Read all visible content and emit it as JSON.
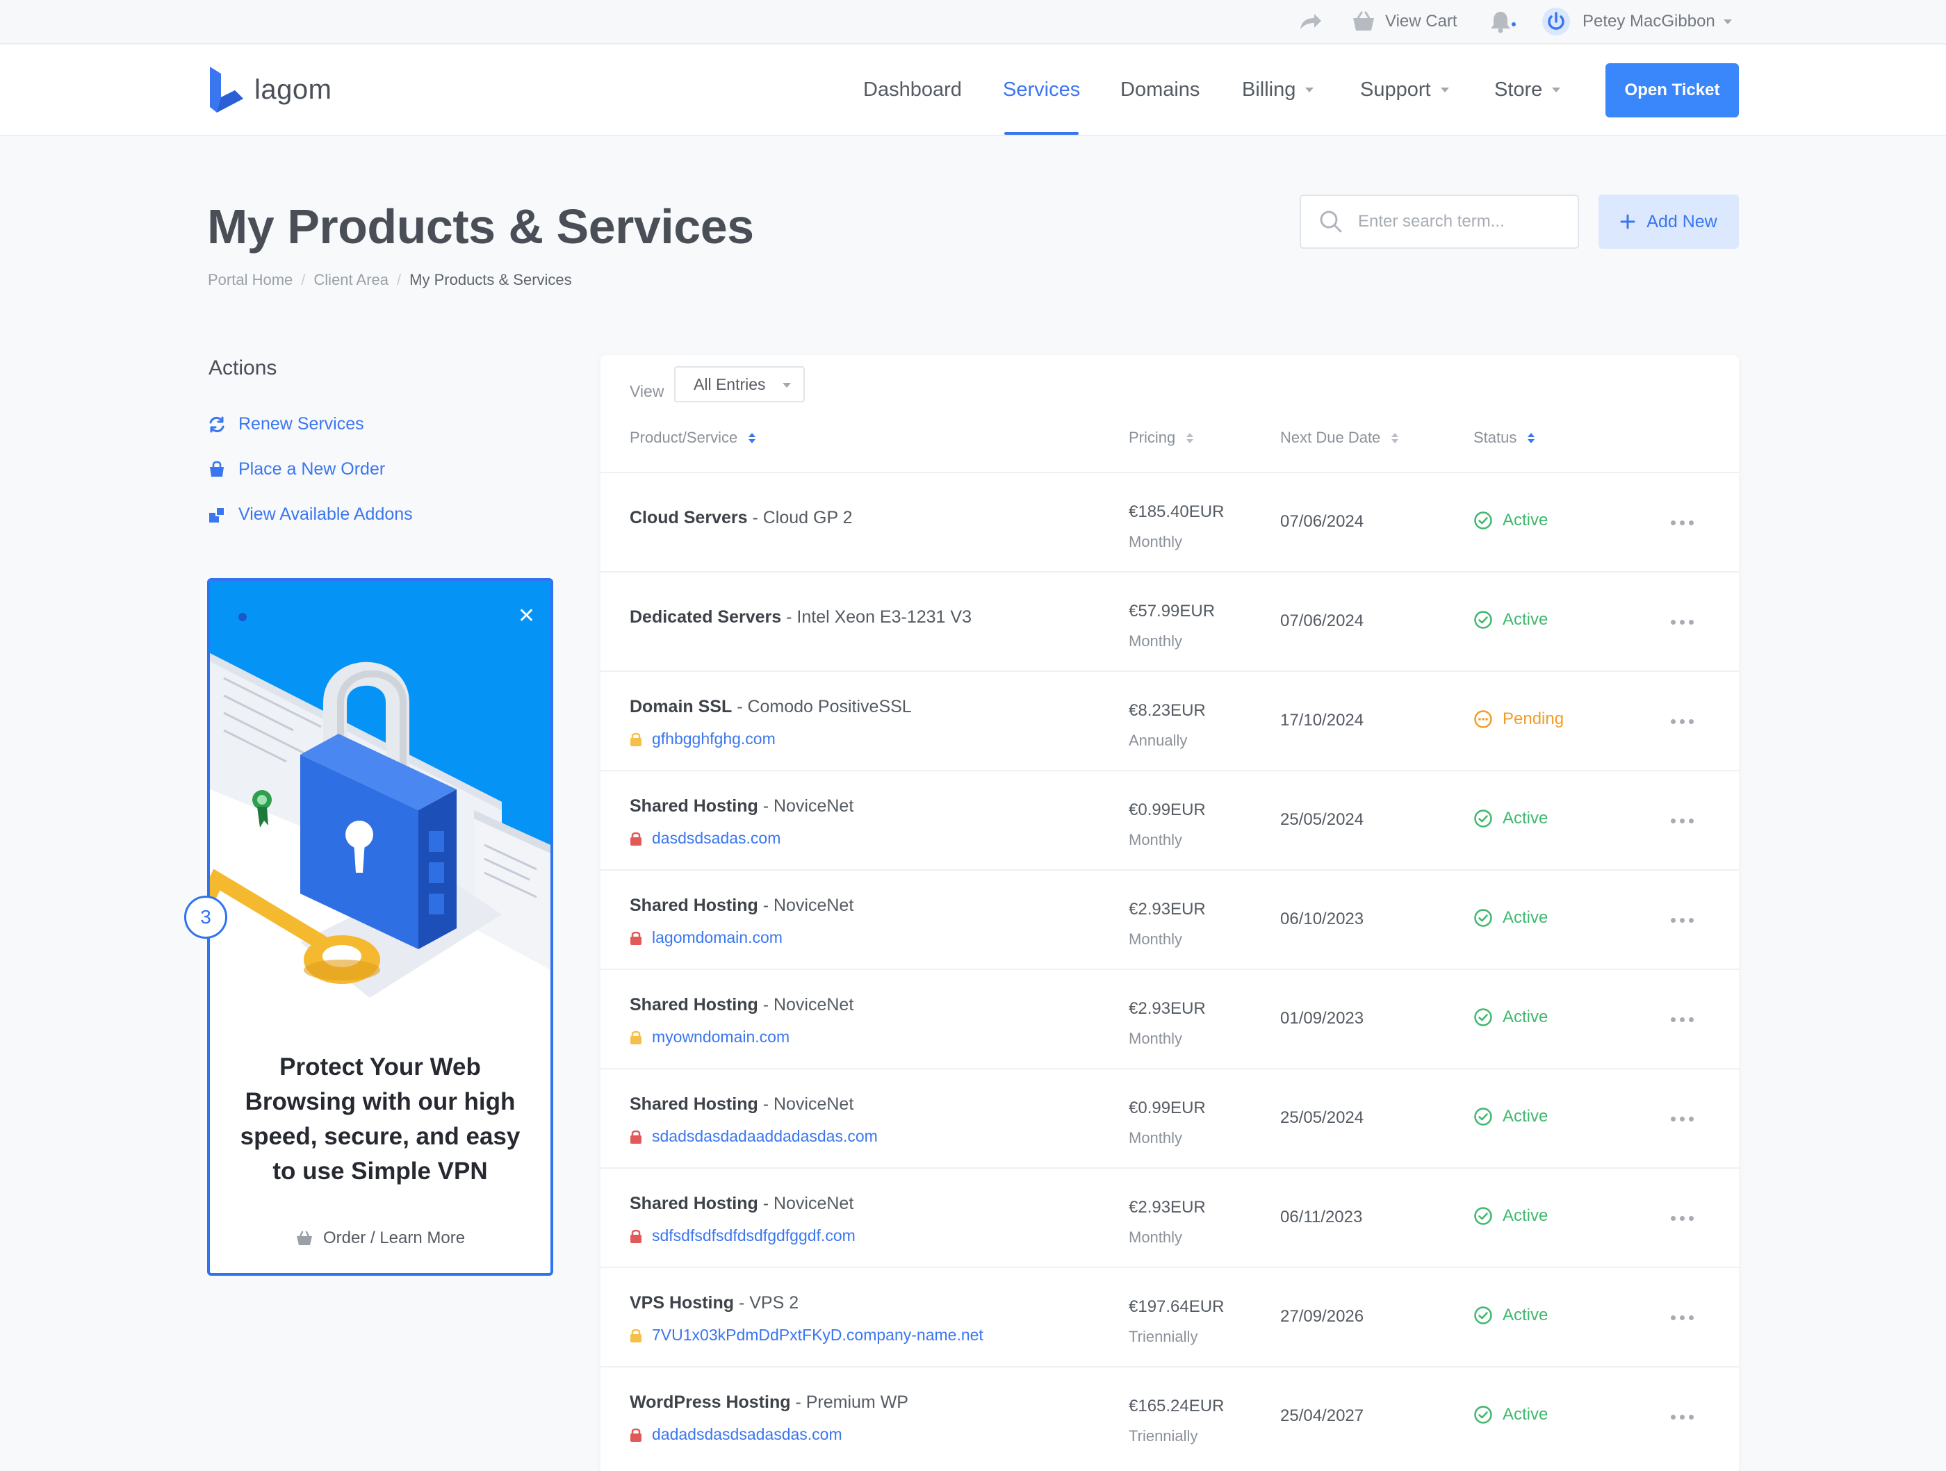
{
  "topbar": {
    "view_cart": "View Cart",
    "user_name": "Petey MacGibbon"
  },
  "brand": {
    "name": "lagom",
    "accent": "#3a76f0"
  },
  "nav": {
    "items": [
      {
        "label": "Dashboard",
        "dropdown": false,
        "active": false
      },
      {
        "label": "Services",
        "dropdown": false,
        "active": true
      },
      {
        "label": "Domains",
        "dropdown": false,
        "active": false
      },
      {
        "label": "Billing",
        "dropdown": true,
        "active": false
      },
      {
        "label": "Support",
        "dropdown": true,
        "active": false
      },
      {
        "label": "Store",
        "dropdown": true,
        "active": false
      }
    ],
    "open_ticket": "Open Ticket"
  },
  "page": {
    "title": "My Products & Services",
    "breadcrumb": [
      "Portal Home",
      "Client Area",
      "My Products & Services"
    ],
    "search_placeholder": "Enter search term...",
    "add_new": "Add New"
  },
  "sidebar": {
    "actions_title": "Actions",
    "actions": [
      {
        "label": "Renew Services",
        "icon": "refresh-icon"
      },
      {
        "label": "Place a New Order",
        "icon": "cart-icon"
      },
      {
        "label": "View Available Addons",
        "icon": "addons-icon"
      }
    ],
    "promo": {
      "headline": "Protect Your Web Browsing with our high speed, secure, and easy to use Simple VPN",
      "link": "Order / Learn More",
      "step_badge": "3"
    }
  },
  "table": {
    "view_label": "View",
    "view_value": "All Entries",
    "headers": {
      "product": "Product/Service",
      "pricing": "Pricing",
      "due": "Next Due Date",
      "status": "Status"
    },
    "rows": [
      {
        "group": "Cloud Servers",
        "product": " - Cloud GP 2",
        "domain": "",
        "lock": "",
        "price": "€185.40EUR",
        "cycle": "Monthly",
        "due": "07/06/2024",
        "status": "Active"
      },
      {
        "group": "Dedicated Servers",
        "product": " - Intel Xeon E3-1231 V3",
        "domain": "",
        "lock": "",
        "price": "€57.99EUR",
        "cycle": "Monthly",
        "due": "07/06/2024",
        "status": "Active"
      },
      {
        "group": "Domain SSL",
        "product": " - Comodo PositiveSSL",
        "domain": "gfhbgghfghg.com",
        "lock": "yellow",
        "price": "€8.23EUR",
        "cycle": "Annually",
        "due": "17/10/2024",
        "status": "Pending"
      },
      {
        "group": "Shared Hosting",
        "product": " - NoviceNet",
        "domain": "dasdsdsadas.com",
        "lock": "red",
        "price": "€0.99EUR",
        "cycle": "Monthly",
        "due": "25/05/2024",
        "status": "Active"
      },
      {
        "group": "Shared Hosting",
        "product": " - NoviceNet",
        "domain": "lagomdomain.com",
        "lock": "red",
        "price": "€2.93EUR",
        "cycle": "Monthly",
        "due": "06/10/2023",
        "status": "Active"
      },
      {
        "group": "Shared Hosting",
        "product": " - NoviceNet",
        "domain": "myowndomain.com",
        "lock": "yellow",
        "price": "€2.93EUR",
        "cycle": "Monthly",
        "due": "01/09/2023",
        "status": "Active"
      },
      {
        "group": "Shared Hosting",
        "product": " - NoviceNet",
        "domain": "sdadsdasdadaaddadasdas.com",
        "lock": "red",
        "price": "€0.99EUR",
        "cycle": "Monthly",
        "due": "25/05/2024",
        "status": "Active"
      },
      {
        "group": "Shared Hosting",
        "product": " - NoviceNet",
        "domain": "sdfsdfsdfsdfdsdfgdfggdf.com",
        "lock": "red",
        "price": "€2.93EUR",
        "cycle": "Monthly",
        "due": "06/11/2023",
        "status": "Active"
      },
      {
        "group": "VPS Hosting",
        "product": " - VPS 2",
        "domain": "7VU1x03kPdmDdPxtFKyD.company-name.net",
        "lock": "yellow",
        "price": "€197.64EUR",
        "cycle": "Triennially",
        "due": "27/09/2026",
        "status": "Active"
      },
      {
        "group": "WordPress Hosting",
        "product": " - Premium WP",
        "domain": "dadadsdasdsadasdas.com",
        "lock": "red",
        "price": "€165.24EUR",
        "cycle": "Triennially",
        "due": "25/04/2027",
        "status": "Active"
      }
    ]
  },
  "colors": {
    "active": "#3fb86e",
    "pending": "#f29d28",
    "lock_red": "#e05a5a",
    "lock_yellow": "#f5c04a",
    "primary_button": "#3a86fb"
  }
}
